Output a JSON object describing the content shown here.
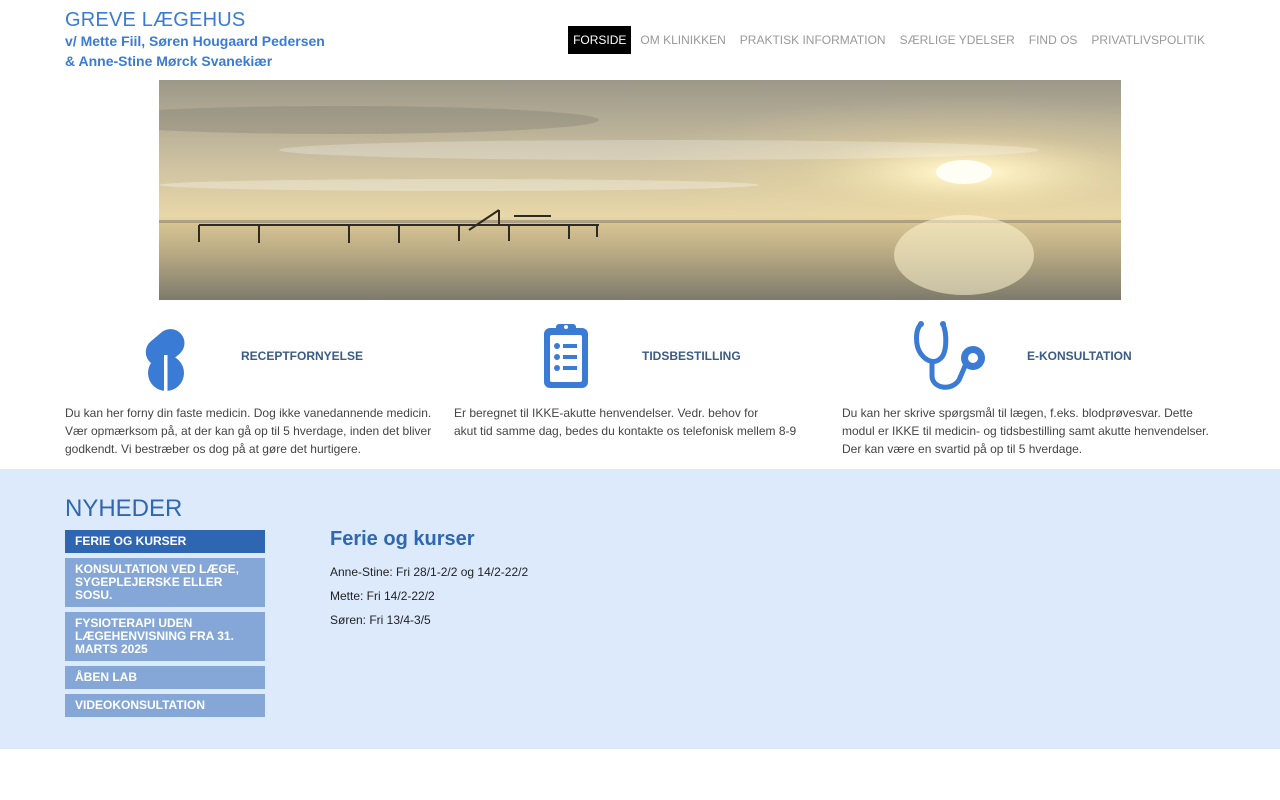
{
  "header": {
    "title": "GREVE LÆGEHUS",
    "subtitle_line1": "v/ Mette Fiil, Søren Hougaard Pedersen",
    "subtitle_line2": "& Anne-Stine Mørck Svanekiær"
  },
  "nav": {
    "items": [
      {
        "label": "FORSIDE",
        "active": true
      },
      {
        "label": "OM KLINIKKEN"
      },
      {
        "label": "PRAKTISK INFORMATION"
      },
      {
        "label": "SÆRLIGE YDELSER"
      },
      {
        "label": "FIND OS"
      },
      {
        "label": "PRIVATLIVSPOLITIK"
      }
    ]
  },
  "features": [
    {
      "icon": "pill-icon",
      "title": "RECEPTFORNYELSE",
      "lines": [
        "Du kan her forny din faste medicin. Dog ikke vanedannende medicin.",
        "Vær opmærksom på, at der kan gå op til 5 hverdage, inden det bliver",
        "godkendt. Vi bestræber os dog på at gøre det hurtigere."
      ]
    },
    {
      "icon": "clipboard-icon",
      "title": "TIDSBESTILLING",
      "lines": [
        "Er beregnet til IKKE-akutte henvendelser. Vedr. behov for",
        "akut tid samme dag,  bedes du kontakte os telefonisk mellem 8-9"
      ]
    },
    {
      "icon": "stethoscope-icon",
      "title": "E-KONSULTATION",
      "lines": [
        "Du kan her skrive spørgsmål til lægen, f.eks. blodprøvesvar. Dette",
        "modul er IKKE til medicin- og tidsbestilling samt akutte henvendelser.",
        "Der kan være en svartid på op til 5 hverdage."
      ]
    }
  ],
  "news": {
    "heading": "NYHEDER",
    "items": [
      {
        "lines": [
          "FERIE OG KURSER"
        ],
        "active": true
      },
      {
        "lines": [
          "KONSULTATION VED LÆGE,",
          "SYGEPLEJERSKE ELLER",
          "SOSU."
        ]
      },
      {
        "lines": [
          "FYSIOTERAPI UDEN",
          "LÆGEHENVISNING FRA 31.",
          "MARTS 2025"
        ]
      },
      {
        "lines": [
          "ÅBEN LAB"
        ]
      },
      {
        "lines": [
          "VIDEOKONSULTATION"
        ]
      }
    ],
    "article": {
      "title": "Ferie og kurser",
      "lines": [
        "Anne-Stine: Fri 28/1-2/2 og 14/2-22/2",
        "Mette: Fri 14/2-22/2",
        "Søren: Fri 13/4-3/5"
      ]
    }
  },
  "colors": {
    "brand_blue": "#3a7bd5",
    "news_bg": "#ddeafc",
    "news_item": "#85a7d7",
    "news_item_active": "#2e66b2",
    "nav_active_bg": "#000000"
  }
}
